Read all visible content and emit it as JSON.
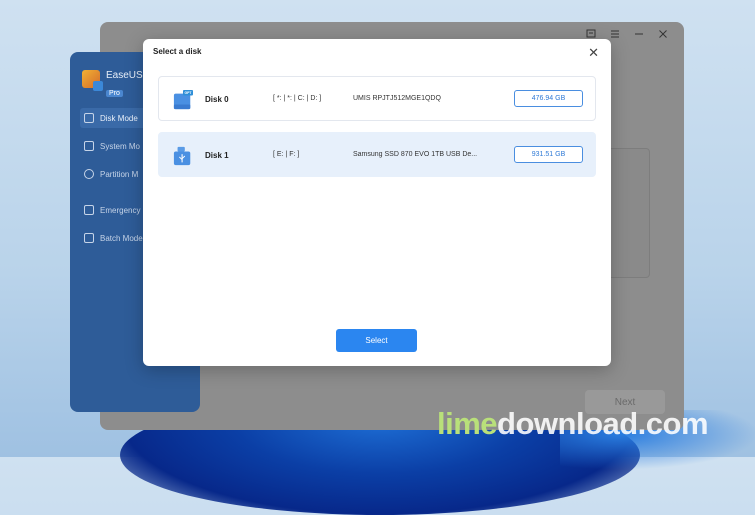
{
  "app": {
    "brand_name": "EaseUS",
    "brand_badge": "Pro",
    "sidebar_items": [
      {
        "label": "Disk Mode",
        "icon": "disk-icon",
        "active": true
      },
      {
        "label": "System Mo",
        "icon": "system-icon",
        "active": false
      },
      {
        "label": "Partition M",
        "icon": "partition-icon",
        "active": false
      },
      {
        "label": "Emergency",
        "icon": "emergency-icon",
        "active": false
      },
      {
        "label": "Batch Mode",
        "icon": "batch-icon",
        "active": false
      }
    ],
    "next_label": "Next",
    "window_controls": [
      "feedback-icon",
      "menu-icon",
      "minimize-icon",
      "close-icon"
    ]
  },
  "dialog": {
    "title": "Select a disk",
    "close_glyph": "✕",
    "select_label": "Select",
    "disks": [
      {
        "name": "Disk 0",
        "partitions": "[ *: | *: | C: | D: ]",
        "model": "UMIS RPJTJ512MGE1QDQ",
        "size": "476.94 GB",
        "badge": "GPT",
        "type": "internal-disk",
        "selected": false
      },
      {
        "name": "Disk 1",
        "partitions": "[ E: | F: ]",
        "model": "Samsung  SSD 870 EVO 1TB  USB De...",
        "size": "931.51 GB",
        "badge": "",
        "type": "usb-disk",
        "selected": true
      }
    ]
  },
  "watermark": {
    "part1": "lime",
    "part2": "download.com"
  },
  "colors": {
    "accent": "#2b86f0",
    "selected_row": "#e7f0fb",
    "sidebar": "#2e5c98"
  }
}
